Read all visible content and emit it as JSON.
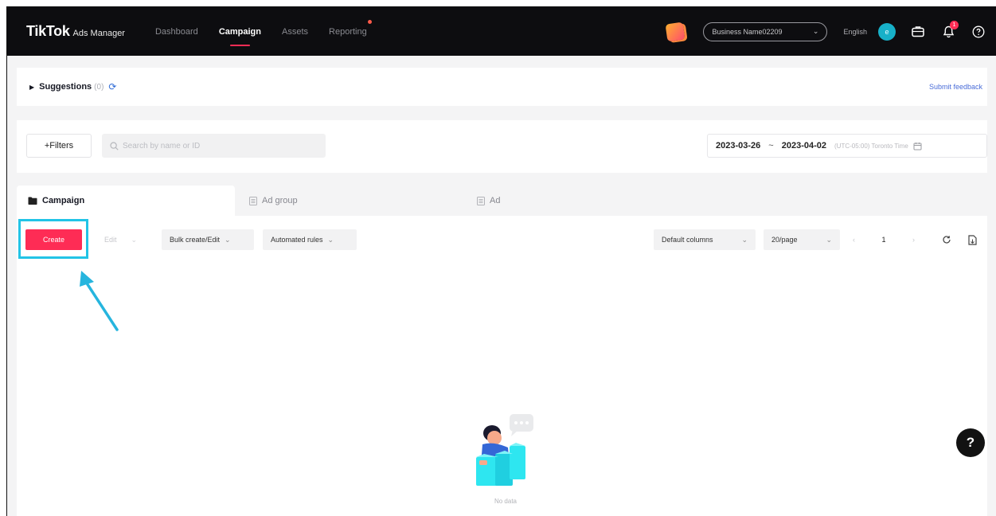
{
  "topbar": {
    "brand": "TikTok",
    "brand_sub": "Ads Manager",
    "nav": [
      "Dashboard",
      "Campaign",
      "Assets",
      "Reporting"
    ],
    "active_nav": "Campaign",
    "account": "Business Name02209",
    "language": "English",
    "avatar_initial": "e",
    "notification_count": "1",
    "icons": [
      "promo-icon",
      "account-chevron-icon",
      "briefcase-icon",
      "bell-icon",
      "help-circle-icon"
    ]
  },
  "suggestions": {
    "title": "Suggestions",
    "count": "(0)",
    "feedback_link": "Submit feedback"
  },
  "filter": {
    "filters_label": "+Filters",
    "search_placeholder": "Search by name or ID",
    "date_start": "2023-03-26",
    "date_sep": "~",
    "date_end": "2023-04-02",
    "timezone": "(UTC-05:00) Toronto Time"
  },
  "tabs": [
    {
      "label": "Campaign",
      "active": true,
      "icon": "folder-icon"
    },
    {
      "label": "Ad group",
      "active": false,
      "icon": "adgroup-icon"
    },
    {
      "label": "Ad",
      "active": false,
      "icon": "ad-icon"
    }
  ],
  "toolbar": {
    "create_label": "Create",
    "edit_label": "Edit",
    "bulk_label": "Bulk create/Edit",
    "rules_label": "Automated rules",
    "columns_label": "Default columns",
    "page_size_label": "20/page",
    "current_page": "1"
  },
  "empty": {
    "text": "No data"
  },
  "colors": {
    "topbar": "#0d0d10",
    "accent": "#fe2c55",
    "highlight": "#22c4e6",
    "link": "#4a6dd8"
  }
}
